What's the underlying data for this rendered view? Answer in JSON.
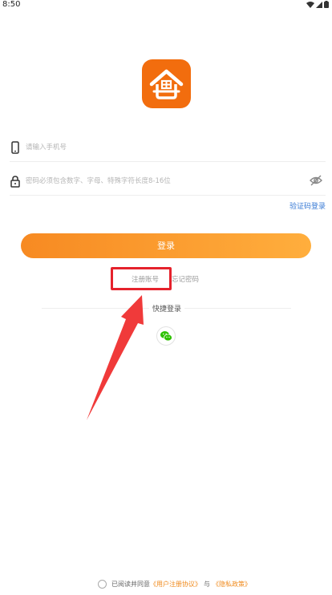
{
  "status": {
    "time": "8:50"
  },
  "login": {
    "phone_placeholder": "请输入手机号",
    "password_placeholder": "密码必须包含数字、字母、特殊字符长度8-16位",
    "sms_login": "验证码登录",
    "login_button": "登录",
    "register": "注册账号",
    "forgot_password": "忘记密码",
    "quick_login": "快捷登录"
  },
  "agreement": {
    "prefix": "已阅读并同意",
    "user_agreement": "《用户注册协议》",
    "conjunction": "与",
    "privacy_policy": "《隐私政策》"
  },
  "colors": {
    "brand_orange": "#f26d0e",
    "button_gradient_start": "#f78a22",
    "button_gradient_end": "#ffae3d",
    "link_blue": "#3a7bd5",
    "highlight_red": "#e5222c",
    "wechat_green": "#2dc100"
  },
  "icons": [
    "signal-icon",
    "wifi-icon",
    "battery-icon",
    "app-logo-icon",
    "phone-icon",
    "lock-icon",
    "eye-off-icon",
    "wechat-icon",
    "annotation-arrow"
  ]
}
